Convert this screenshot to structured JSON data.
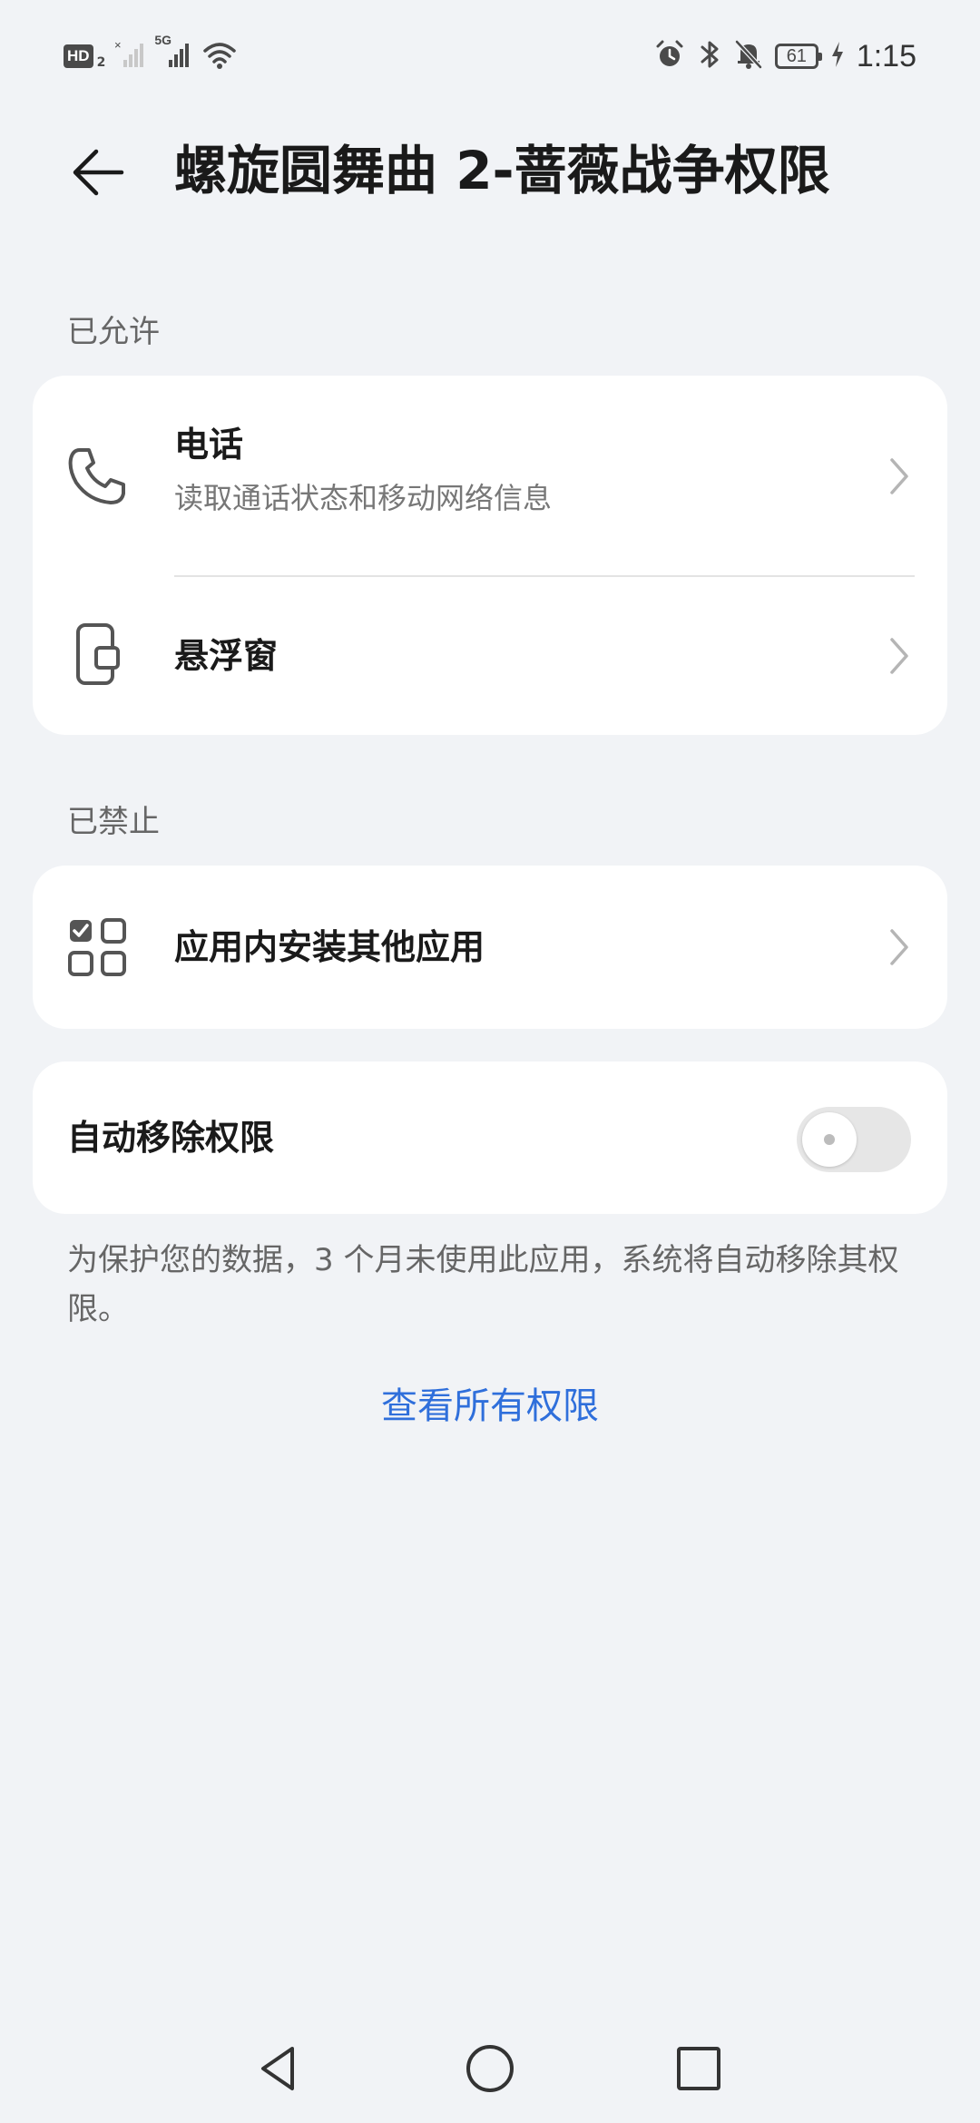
{
  "status_bar": {
    "hd_label": "HD",
    "hd_sub": "2",
    "signal_tag": "5G",
    "battery": "61",
    "time": "1:15",
    "icons": [
      "x-signal-icon",
      "signal-icon",
      "wifi-icon",
      "alarm-icon",
      "bluetooth-icon",
      "mute-icon",
      "battery-icon",
      "charging-icon"
    ]
  },
  "header": {
    "back_icon": "arrow-left-icon",
    "title": "螺旋圆舞曲 2-蔷薇战争权限"
  },
  "allowed": {
    "label": "已允许",
    "items": [
      {
        "icon": "phone-icon",
        "title": "电话",
        "subtitle": "读取通话状态和移动网络信息"
      },
      {
        "icon": "floating-window-icon",
        "title": "悬浮窗"
      }
    ]
  },
  "denied": {
    "label": "已禁止",
    "items": [
      {
        "icon": "app-install-icon",
        "title": "应用内安装其他应用"
      }
    ]
  },
  "auto_remove": {
    "label": "自动移除权限",
    "enabled": false,
    "note": "为保护您的数据，3 个月未使用此应用，系统将自动移除其权限。"
  },
  "view_all": {
    "label": "查看所有权限"
  },
  "colors": {
    "background": "#f1f3f6",
    "card": "#ffffff",
    "accent": "#2f6fdb",
    "secondary_text": "#777777"
  },
  "nav_bar": {
    "icons": [
      "back-triangle-icon",
      "home-circle-icon",
      "recents-square-icon"
    ]
  }
}
